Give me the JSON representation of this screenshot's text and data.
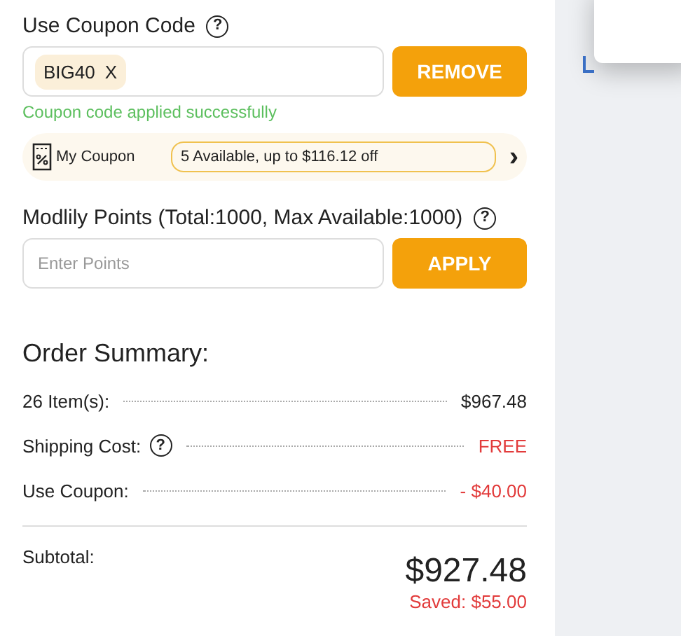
{
  "coupon": {
    "label": "Use Coupon Code",
    "help": "?",
    "applied_code": "BIG40",
    "remove_mark": "X",
    "button": "REMOVE",
    "message": "Coupon code applied successfully"
  },
  "my_coupon": {
    "label": "My Coupon",
    "summary": "5 Available, up to $116.12 off",
    "chevron": "›"
  },
  "points": {
    "label": "Modlily Points (Total:1000, Max Available:1000)",
    "help": "?",
    "placeholder": "Enter Points",
    "button": "APPLY"
  },
  "summary": {
    "title": "Order Summary:",
    "rows": [
      {
        "label": "26 Item(s):",
        "value": "$967.48",
        "kind": "plain",
        "help": null
      },
      {
        "label": "Shipping Cost:",
        "value": "FREE",
        "kind": "discount",
        "help": "?"
      },
      {
        "label": "Use Coupon:",
        "value": "- $40.00",
        "kind": "discount",
        "help": null
      }
    ],
    "subtotal_label": "Subtotal:",
    "subtotal": "$927.48",
    "saved": "Saved: $55.00"
  }
}
